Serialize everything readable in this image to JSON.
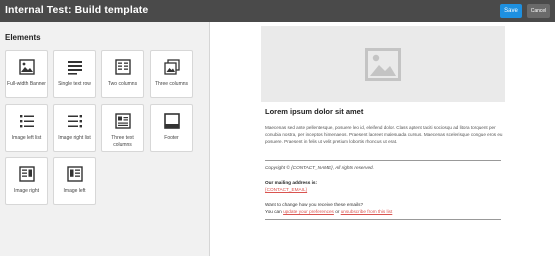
{
  "header": {
    "title": "Internal Test: Build template",
    "save_label": "Save",
    "cancel_label": "Cancel",
    "save_color": "#1e90e0"
  },
  "sidebar": {
    "heading": "Elements",
    "tiles": [
      {
        "label": "Full-width Banner",
        "icon": "banner-icon"
      },
      {
        "label": "Single text row",
        "icon": "text-rows-icon"
      },
      {
        "label": "Two columns",
        "icon": "two-columns-icon"
      },
      {
        "label": "Three columns",
        "icon": "three-columns-icon"
      },
      {
        "label": "Image left list",
        "icon": "image-left-list-icon"
      },
      {
        "label": "Image right list",
        "icon": "image-right-list-icon"
      },
      {
        "label": "Three text columns",
        "icon": "three-text-columns-icon"
      },
      {
        "label": "Footer",
        "icon": "footer-icon"
      },
      {
        "label": "Image right",
        "icon": "image-right-icon"
      },
      {
        "label": "Image left",
        "icon": "image-left-icon"
      }
    ]
  },
  "canvas": {
    "banner_icon": "image-placeholder-icon",
    "title": "Lorem ipsum dolor sit amet",
    "body": "Maecenas sed ante pellentesque, posuere leo id, eleifend dolor. Class aptent taciti sociosqu ad litora torquent per conubia nostra, per inceptos himenaeos. Praesent laoreet malesuada cursus. Maecenas scelerisque congue eros eu posuere. Praesent in felis ut velit pretium lobortis rhoncus ut erat.",
    "footer": {
      "copyright": "Copyright © {CONTACT_NAME}, All rights reserved.",
      "mailing_label": "Our mailing address is:",
      "mailing_value": "{CONTACT_EMAIL}",
      "change_question": "Want to change how you receive these emails?",
      "you_can": "You can ",
      "update_link": "update your preferences",
      "or": " or ",
      "unsubscribe_link": "unsubscribe from this list"
    }
  }
}
